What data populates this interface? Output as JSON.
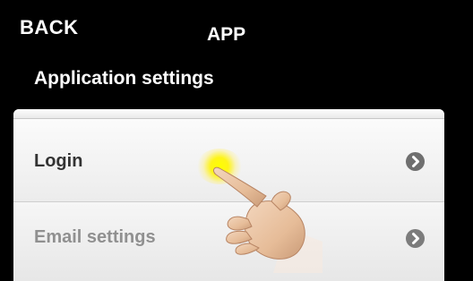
{
  "header": {
    "back_label": "BACK",
    "app_title": "APP",
    "section_title": "Application settings"
  },
  "settings": {
    "items": [
      {
        "label": "Login",
        "icon": "chevron-right-icon",
        "enabled": true
      },
      {
        "label": "Email settings",
        "icon": "chevron-right-icon",
        "enabled": false
      }
    ]
  },
  "overlay": {
    "pointer_icon": "pointing-hand-icon",
    "touch_indicator_color": "#ffff00"
  }
}
